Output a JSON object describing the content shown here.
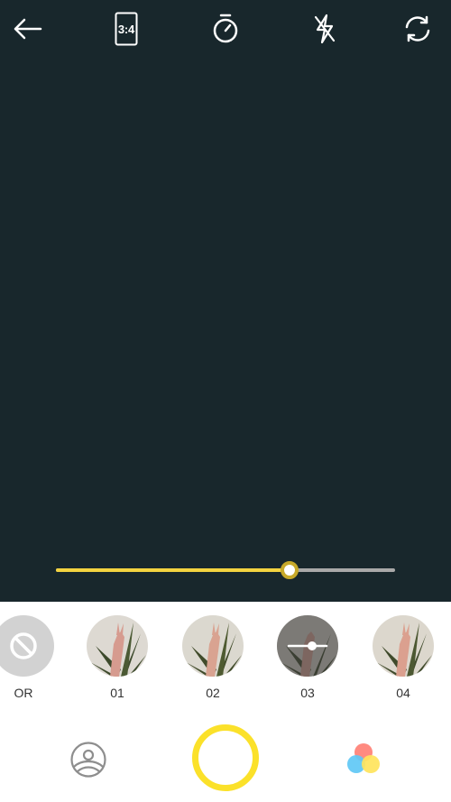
{
  "topbar": {
    "back_icon": "arrow-left-icon",
    "ratio_label": "3:4",
    "timer_icon": "timer-icon",
    "flash_icon": "flash-off-icon",
    "switch_icon": "switch-camera-icon"
  },
  "intensity": {
    "value": 0.69,
    "fill_color": "#f3d340",
    "track_color": "#a9a9a9"
  },
  "filters": [
    {
      "label": "OR",
      "icon": "no-filter-icon"
    },
    {
      "label": "01"
    },
    {
      "label": "02"
    },
    {
      "label": "03",
      "selected": true,
      "icon": "adjust-icon"
    },
    {
      "label": "04"
    }
  ],
  "bottom": {
    "gallery_icon": "gallery-icon",
    "shutter_color": "#fbe12a",
    "color_icon": "color-filter-icon",
    "color_dots": [
      "#ff8a80",
      "#5fc8f5",
      "#ffe45c"
    ]
  },
  "colors": {
    "viewfinder": "#18272c",
    "accent": "#fbe12a"
  }
}
